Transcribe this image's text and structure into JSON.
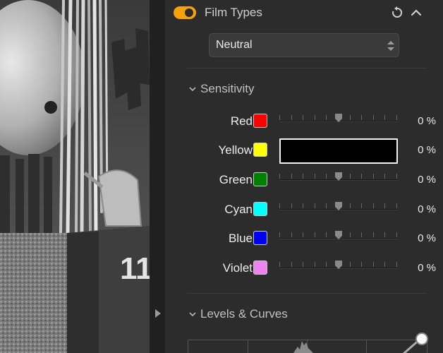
{
  "photo": {
    "sign_text": "11"
  },
  "film_types": {
    "title": "Film Types",
    "enabled": true,
    "preset": "Neutral",
    "icons": {
      "reset": "reset-icon",
      "collapse": "chevron-up-icon"
    }
  },
  "sensitivity": {
    "title": "Sensitivity",
    "channels": [
      {
        "name": "Red",
        "color": "#ff0000",
        "value": 0,
        "display": "0 %",
        "mode": "slider"
      },
      {
        "name": "Yellow",
        "color": "#ffff00",
        "value": 0,
        "display": "0 %",
        "mode": "picker"
      },
      {
        "name": "Green",
        "color": "#008000",
        "value": 0,
        "display": "0 %",
        "mode": "slider"
      },
      {
        "name": "Cyan",
        "color": "#00ffff",
        "value": 0,
        "display": "0 %",
        "mode": "slider"
      },
      {
        "name": "Blue",
        "color": "#0000ff",
        "value": 0,
        "display": "0 %",
        "mode": "slider"
      },
      {
        "name": "Violet",
        "color": "#ee82ee",
        "value": 0,
        "display": "0 %",
        "mode": "slider"
      }
    ]
  },
  "levels_curves": {
    "title": "Levels & Curves"
  },
  "colors": {
    "accent": "#f5a30a"
  }
}
